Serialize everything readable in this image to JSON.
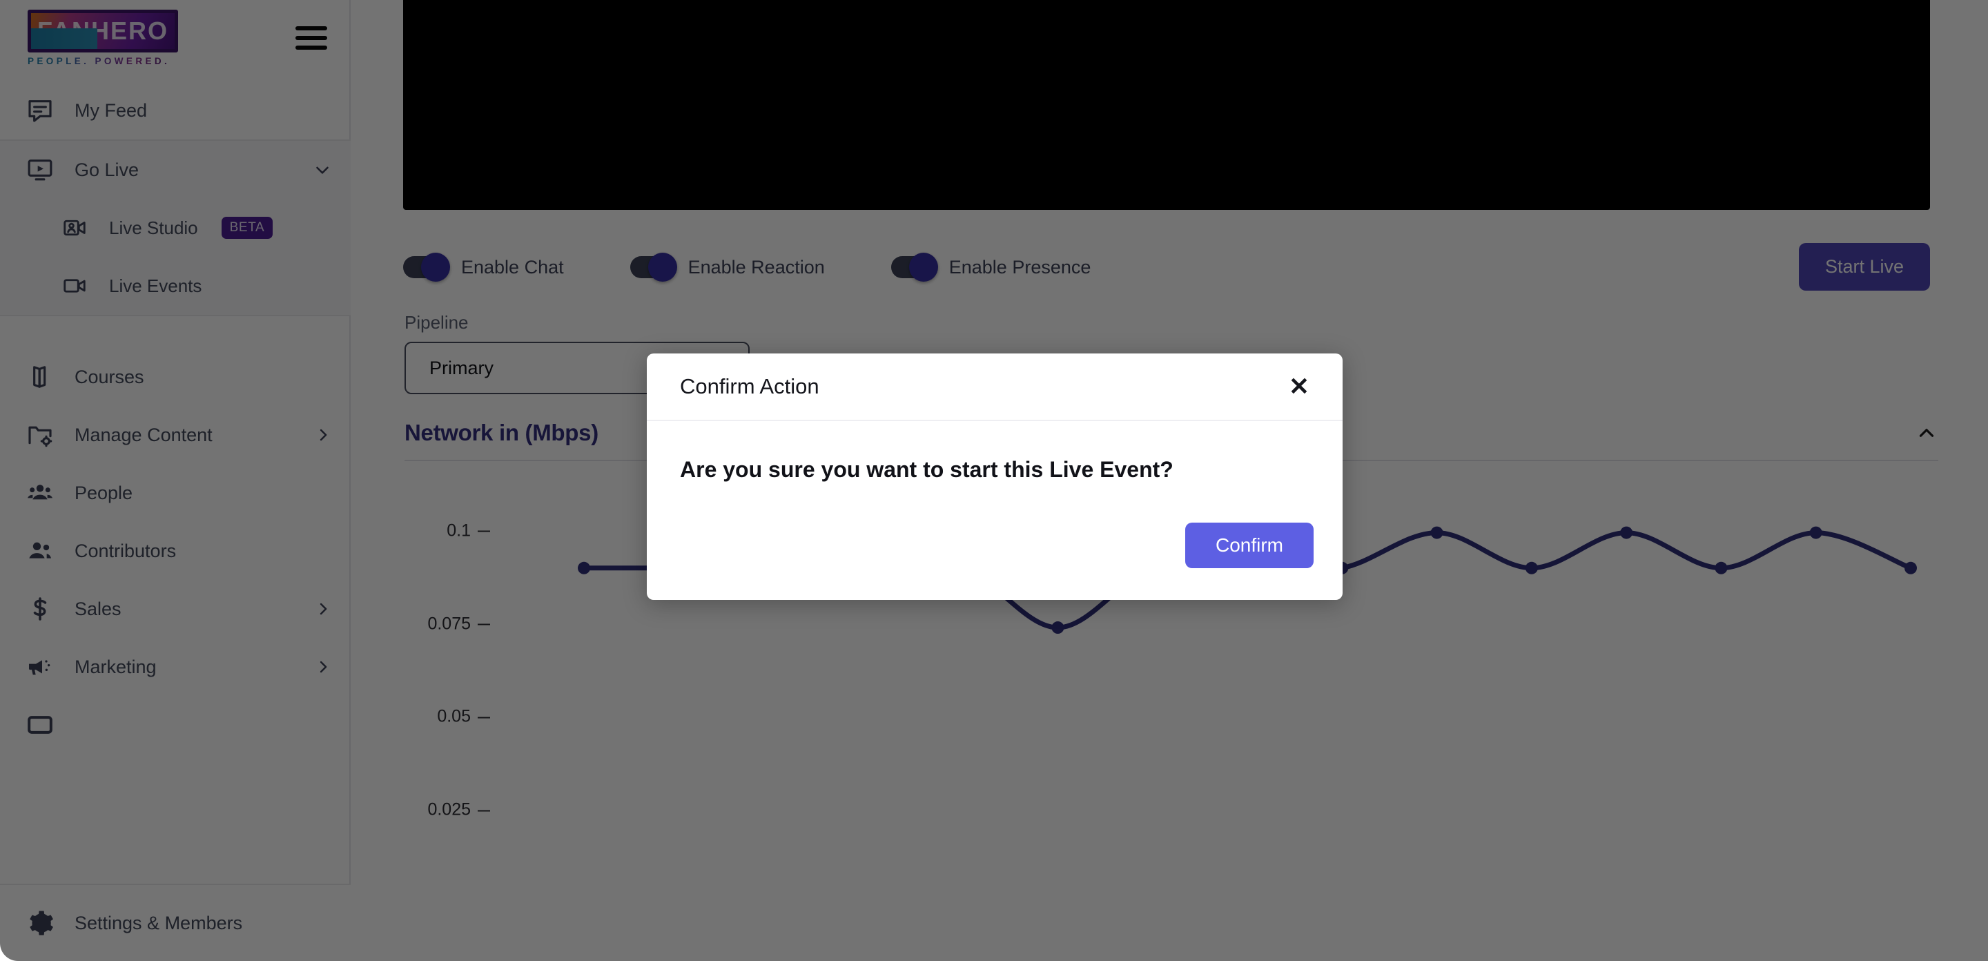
{
  "brand": {
    "logo_text": "FANHERO",
    "tagline": "PEOPLE. POWERED.",
    "accent_purple": "#3d1468",
    "accent_indigo": "#5d5fe3"
  },
  "sidebar": {
    "menu_icon": "hamburger-icon",
    "groups": [
      {
        "items": [
          {
            "label": "My Feed",
            "icon": "feed-icon",
            "chevron": "",
            "badge": ""
          }
        ]
      },
      {
        "shaded": true,
        "items": [
          {
            "label": "Go Live",
            "icon": "go-live-icon",
            "chevron": "⌄",
            "badge": ""
          },
          {
            "label": "Live Studio",
            "icon": "live-studio-icon",
            "chevron": "",
            "badge": "BETA",
            "sub": true
          },
          {
            "label": "Live Events",
            "icon": "live-events-icon",
            "chevron": "",
            "badge": "",
            "sub": true
          }
        ]
      },
      {
        "items": [
          {
            "label": "Courses",
            "icon": "courses-icon",
            "chevron": "",
            "badge": ""
          },
          {
            "label": "Manage Content",
            "icon": "manage-content-icon",
            "chevron": "›",
            "badge": ""
          },
          {
            "label": "People",
            "icon": "people-icon",
            "chevron": "",
            "badge": ""
          },
          {
            "label": "Contributors",
            "icon": "contributors-icon",
            "chevron": "",
            "badge": ""
          },
          {
            "label": "Sales",
            "icon": "sales-icon",
            "chevron": "›",
            "badge": ""
          },
          {
            "label": "Marketing",
            "icon": "marketing-icon",
            "chevron": "›",
            "badge": ""
          }
        ]
      }
    ],
    "bottom": {
      "label": "Settings & Members",
      "icon": "gear-icon"
    }
  },
  "main": {
    "toggles": [
      {
        "label": "Enable Chat",
        "on": true
      },
      {
        "label": "Enable Reaction",
        "on": true
      },
      {
        "label": "Enable Presence",
        "on": true
      }
    ],
    "start_live_label": "Start Live",
    "pipeline": {
      "label": "Pipeline",
      "value": "Primary"
    }
  },
  "chart_data": {
    "type": "line",
    "title": "Network in (Mbps)",
    "xlabel": "",
    "ylabel": "",
    "grid": false,
    "legend": "none",
    "ytick_labels": [
      "0.1",
      "0.075",
      "0.05",
      "0.025"
    ],
    "ytick_values": [
      0.1,
      0.075,
      0.05,
      0.025
    ],
    "ylim": [
      0,
      0.115
    ],
    "collapse_icon": "chevron-up-icon",
    "line_color": "#2f2f7a",
    "x": [
      0,
      1,
      2,
      3,
      4,
      5,
      6,
      7,
      8,
      9,
      10,
      11,
      12,
      13,
      14
    ],
    "values": [
      0.09,
      0.09,
      0.09,
      0.09,
      0.09,
      0.074,
      0.09,
      0.09,
      0.09,
      0.0995,
      0.09,
      0.0995,
      0.09,
      0.0995,
      0.09
    ]
  },
  "modal": {
    "title": "Confirm Action",
    "close_icon": "close-icon",
    "message": "Are you sure you want to start this Live Event?",
    "confirm_label": "Confirm"
  }
}
